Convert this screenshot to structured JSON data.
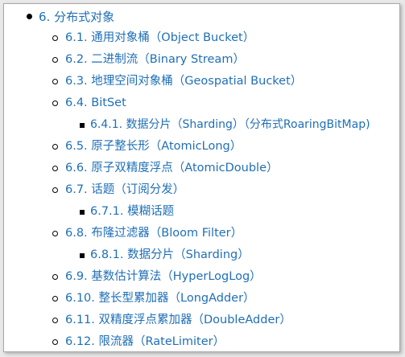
{
  "colors": {
    "link": "#1f6fb6",
    "background": "#ffffff",
    "border": "#a8a8a8"
  },
  "toc": {
    "root": {
      "label": "6. 分布式对象"
    },
    "items": [
      {
        "label": "6.1. 通用对象桶（Object Bucket）"
      },
      {
        "label": "6.2. 二进制流（Binary Stream）"
      },
      {
        "label": "6.3. 地理空间对象桶（Geospatial Bucket）"
      },
      {
        "label": "6.4. BitSet",
        "children": [
          {
            "label": "6.4.1. 数据分片（Sharding）（分布式RoaringBitMap)"
          }
        ]
      },
      {
        "label": "6.5. 原子整长形（AtomicLong）"
      },
      {
        "label": "6.6. 原子双精度浮点（AtomicDouble）"
      },
      {
        "label": "6.7. 话题（订阅分发）",
        "children": [
          {
            "label": "6.7.1. 模糊话题"
          }
        ]
      },
      {
        "label": "6.8. 布隆过滤器（Bloom Filter）",
        "children": [
          {
            "label": "6.8.1. 数据分片（Sharding）"
          }
        ]
      },
      {
        "label": "6.9. 基数估计算法（HyperLogLog）"
      },
      {
        "label": "6.10. 整长型累加器（LongAdder）"
      },
      {
        "label": "6.11. 双精度浮点累加器（DoubleAdder）"
      },
      {
        "label": "6.12. 限流器（RateLimiter）"
      }
    ]
  }
}
